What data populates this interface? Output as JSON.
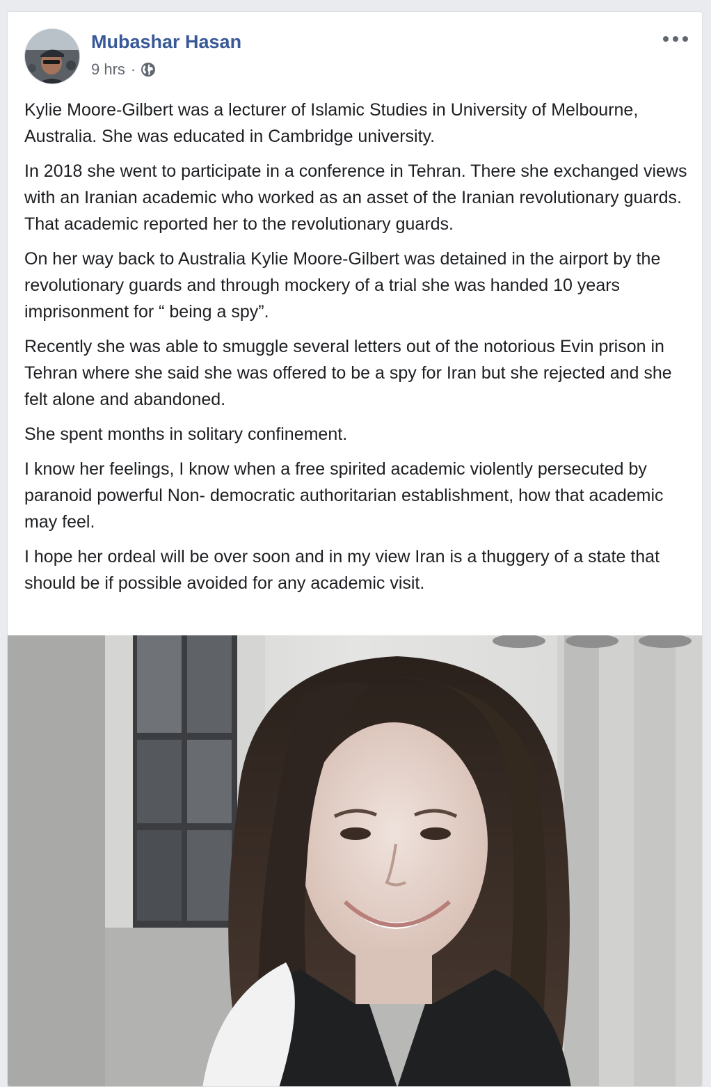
{
  "post": {
    "author": "Mubashar Hasan",
    "timestamp": "9 hrs",
    "separator": "·",
    "privacy_icon": "globe-icon",
    "more_icon": "more-options-icon",
    "paragraphs": [
      "Kylie Moore-Gilbert was a lecturer of Islamic Studies in University of Melbourne, Australia. She was educated in Cambridge university.",
      "In 2018 she went to participate in a conference in Tehran. There she exchanged views with an Iranian academic who worked as an asset of the Iranian revolutionary guards. That academic reported her to the revolutionary guards.",
      "On her way back to Australia Kylie Moore-Gilbert was detained in the airport by the revolutionary guards and through mockery of a trial she was handed 10 years imprisonment for “ being a spy”.",
      "Recently she was able to smuggle several letters out of the notorious Evin prison in Tehran where she said she was offered to be a spy for Iran but she rejected and she felt alone and abandoned.",
      "She spent months in solitary confinement.",
      "I know her feelings, I know when a free spirited academic violently persecuted by paranoid powerful Non- democratic authoritarian establishment, how that academic may feel.",
      "I hope her ordeal will be over soon and in my view Iran is a thuggery of a state that should be if possible avoided for any academic visit."
    ]
  },
  "colors": {
    "author_link": "#385898",
    "body_text": "#1c1e21",
    "meta_text": "#616770",
    "page_bg": "#e9ebee"
  }
}
